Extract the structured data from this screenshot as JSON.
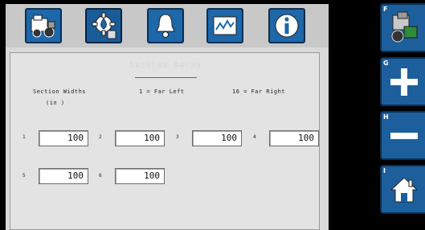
{
  "tabs": [
    {
      "name": "machine-setup-icon"
    },
    {
      "name": "settings-gear-icon"
    },
    {
      "name": "alarm-bell-icon"
    },
    {
      "name": "monitor-chart-icon"
    },
    {
      "name": "info-icon"
    }
  ],
  "panel": {
    "title": "Section Setup",
    "header_widths": "Section Widths",
    "header_units": "(in     )",
    "header_left": "1 = Far Left",
    "header_right": "16 = Far Right"
  },
  "sections": [
    {
      "num": "1",
      "value": "100"
    },
    {
      "num": "2",
      "value": "100"
    },
    {
      "num": "3",
      "value": "100"
    },
    {
      "num": "4",
      "value": "100"
    },
    {
      "num": "5",
      "value": "100"
    },
    {
      "num": "6",
      "value": "100"
    }
  ],
  "softkeys": [
    {
      "letter": "F",
      "icon": "tractor-icon"
    },
    {
      "letter": "G",
      "icon": "plus-icon"
    },
    {
      "letter": "H",
      "icon": "minus-icon"
    },
    {
      "letter": "I",
      "icon": "home-icon"
    }
  ],
  "colors": {
    "button_blue": "#1e67a8",
    "button_border": "#0c2f52",
    "panel_bg": "#e3e3e3"
  }
}
